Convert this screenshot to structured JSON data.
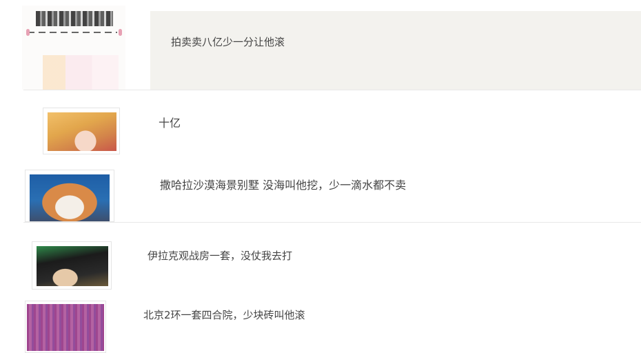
{
  "comments": [
    {
      "text": "拍卖卖八亿少一分让他滚"
    },
    {
      "text": "十亿"
    },
    {
      "text": "撒哈拉沙漠海景别墅 没海叫他挖，少一滴水都不卖"
    },
    {
      "text": "伊拉克观战房一套，没仗我去打"
    },
    {
      "text": "北京2环一套四合院，少块砖叫他滚"
    }
  ],
  "colors": {
    "highlight_row_bg": "#f3f2ee",
    "divider": "#e8e8e8",
    "text": "#444444"
  }
}
